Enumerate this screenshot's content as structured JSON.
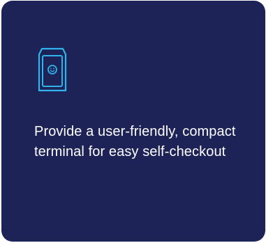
{
  "card": {
    "background_color": "#1d2257",
    "icon": "self-checkout-terminal-icon",
    "icon_color": "#2fb4ec",
    "description": "Provide a user-friendly, compact terminal for easy self-checkout"
  }
}
